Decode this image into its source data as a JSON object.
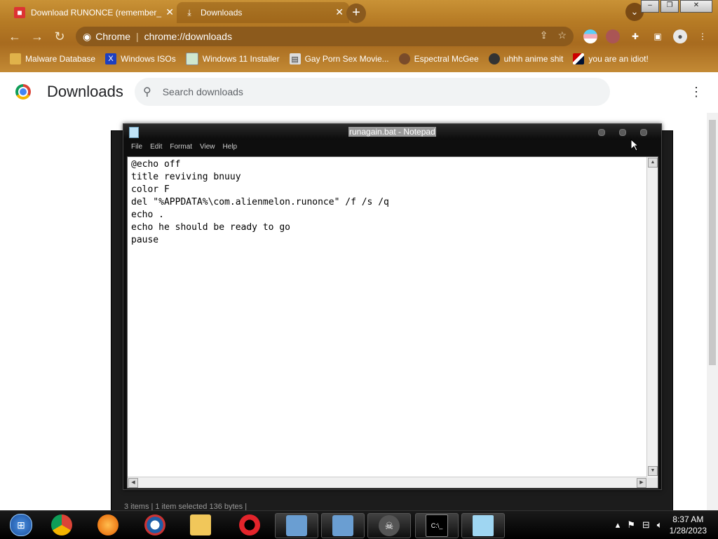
{
  "browser": {
    "tabs": [
      {
        "title": "Download RUNONCE (remember_",
        "icon": "gift-icon",
        "active": false
      },
      {
        "title": "Downloads",
        "icon": "download-icon",
        "active": true
      }
    ],
    "new_tab": "+",
    "omnibox": {
      "site": "Chrome",
      "url": "chrome://downloads"
    },
    "bookmarks": [
      {
        "label": "Malware Database",
        "icon": "folder-icon"
      },
      {
        "label": "Windows ISOs",
        "icon": "x-icon"
      },
      {
        "label": "Windows 11 Installer",
        "icon": "picture-icon"
      },
      {
        "label": "Gay Porn Sex Movie...",
        "icon": "monitor-icon"
      },
      {
        "label": "Espectral McGee",
        "icon": "avatar-icon"
      },
      {
        "label": "uhhh anime shit",
        "icon": "anime-icon"
      },
      {
        "label": "you are an idiot!",
        "icon": "flag-icon"
      }
    ]
  },
  "downloads_page": {
    "title": "Downloads",
    "search_placeholder": "Search downloads"
  },
  "notepad": {
    "title": "runagain.bat - Notepad",
    "menu": [
      "File",
      "Edit",
      "Format",
      "View",
      "Help"
    ],
    "content": "@echo off\ntitle reviving bnuuy\ncolor F\ndel \"%APPDATA%\\com.alienmelon.runonce\" /f /s /q\necho .\necho he should be ready to go\npause"
  },
  "background_window": {
    "status": "3 items   |   1 item selected  136 bytes   |"
  },
  "taskbar": {
    "items": [
      "start-orb",
      "chrome",
      "firefox",
      "obama",
      "file-explorer",
      "opera",
      "installer-1",
      "installer-2",
      "skull-app",
      "cmd",
      "notepad"
    ],
    "clock_time": "8:37 AM",
    "clock_date": "1/28/2023"
  }
}
